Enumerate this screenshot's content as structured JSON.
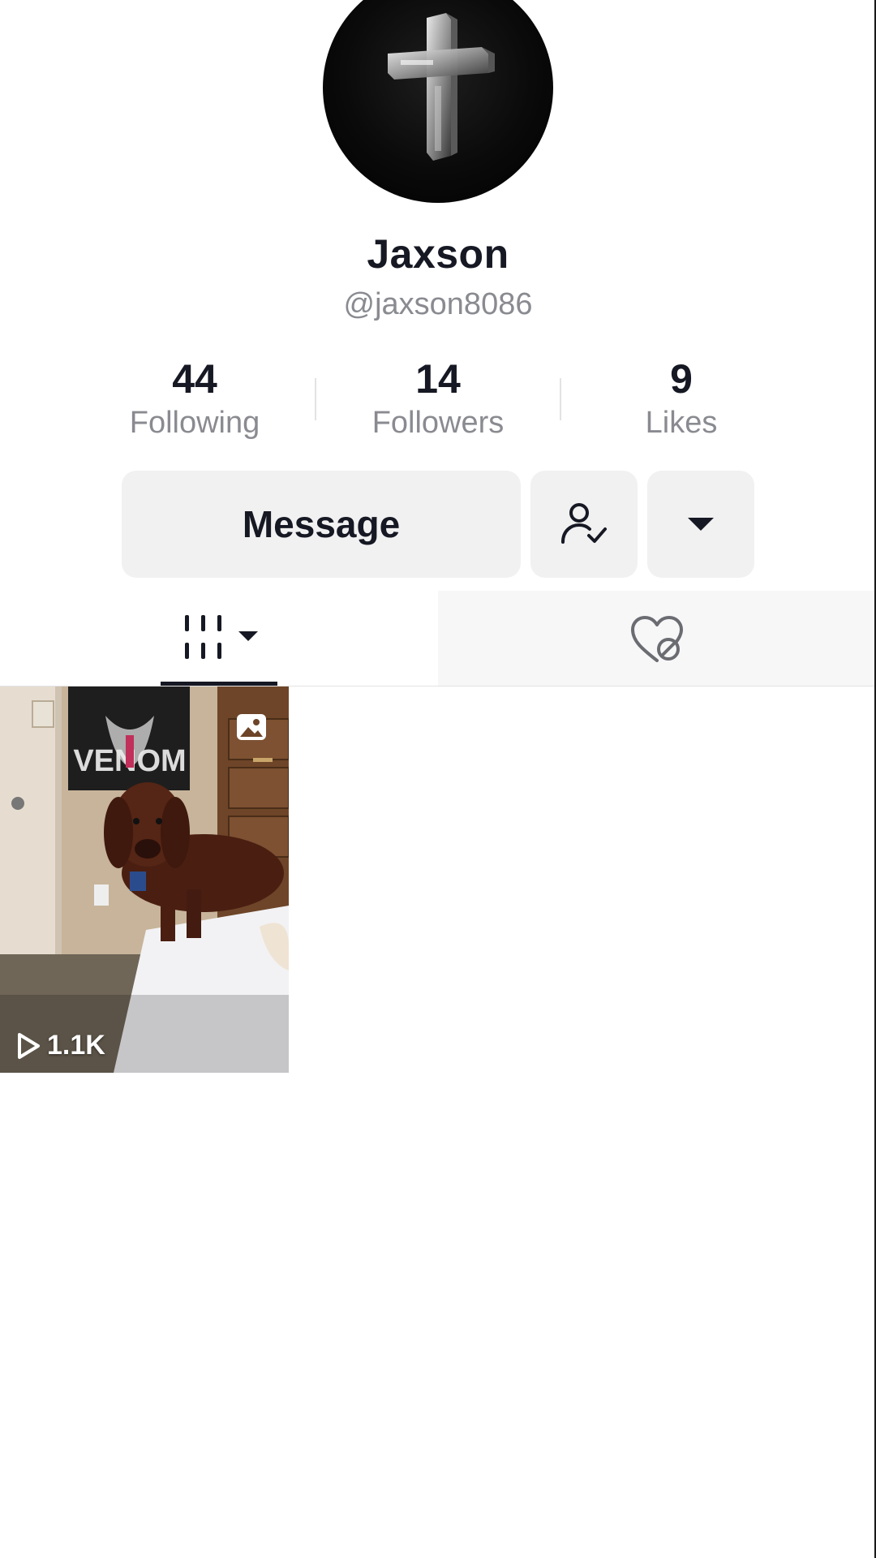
{
  "profile": {
    "display_name": "Jaxson",
    "username": "@jaxson8086",
    "avatar_icon": "cross-avatar"
  },
  "stats": [
    {
      "value": "44",
      "label": "Following"
    },
    {
      "value": "14",
      "label": "Followers"
    },
    {
      "value": "9",
      "label": "Likes"
    }
  ],
  "actions": {
    "message_label": "Message",
    "follow_status_icon": "user-check-icon",
    "more_icon": "caret-down-icon"
  },
  "tabs": [
    {
      "name": "videos",
      "icon": "grid-icon",
      "selected": true
    },
    {
      "name": "liked",
      "icon": "liked-hidden-icon",
      "selected": false
    }
  ],
  "videos": [
    {
      "views": "1.1K",
      "type_icon": "photo-icon"
    }
  ],
  "colors": {
    "text_primary": "#161823",
    "text_secondary": "#8a8b91",
    "button_bg": "#f1f1f2"
  }
}
